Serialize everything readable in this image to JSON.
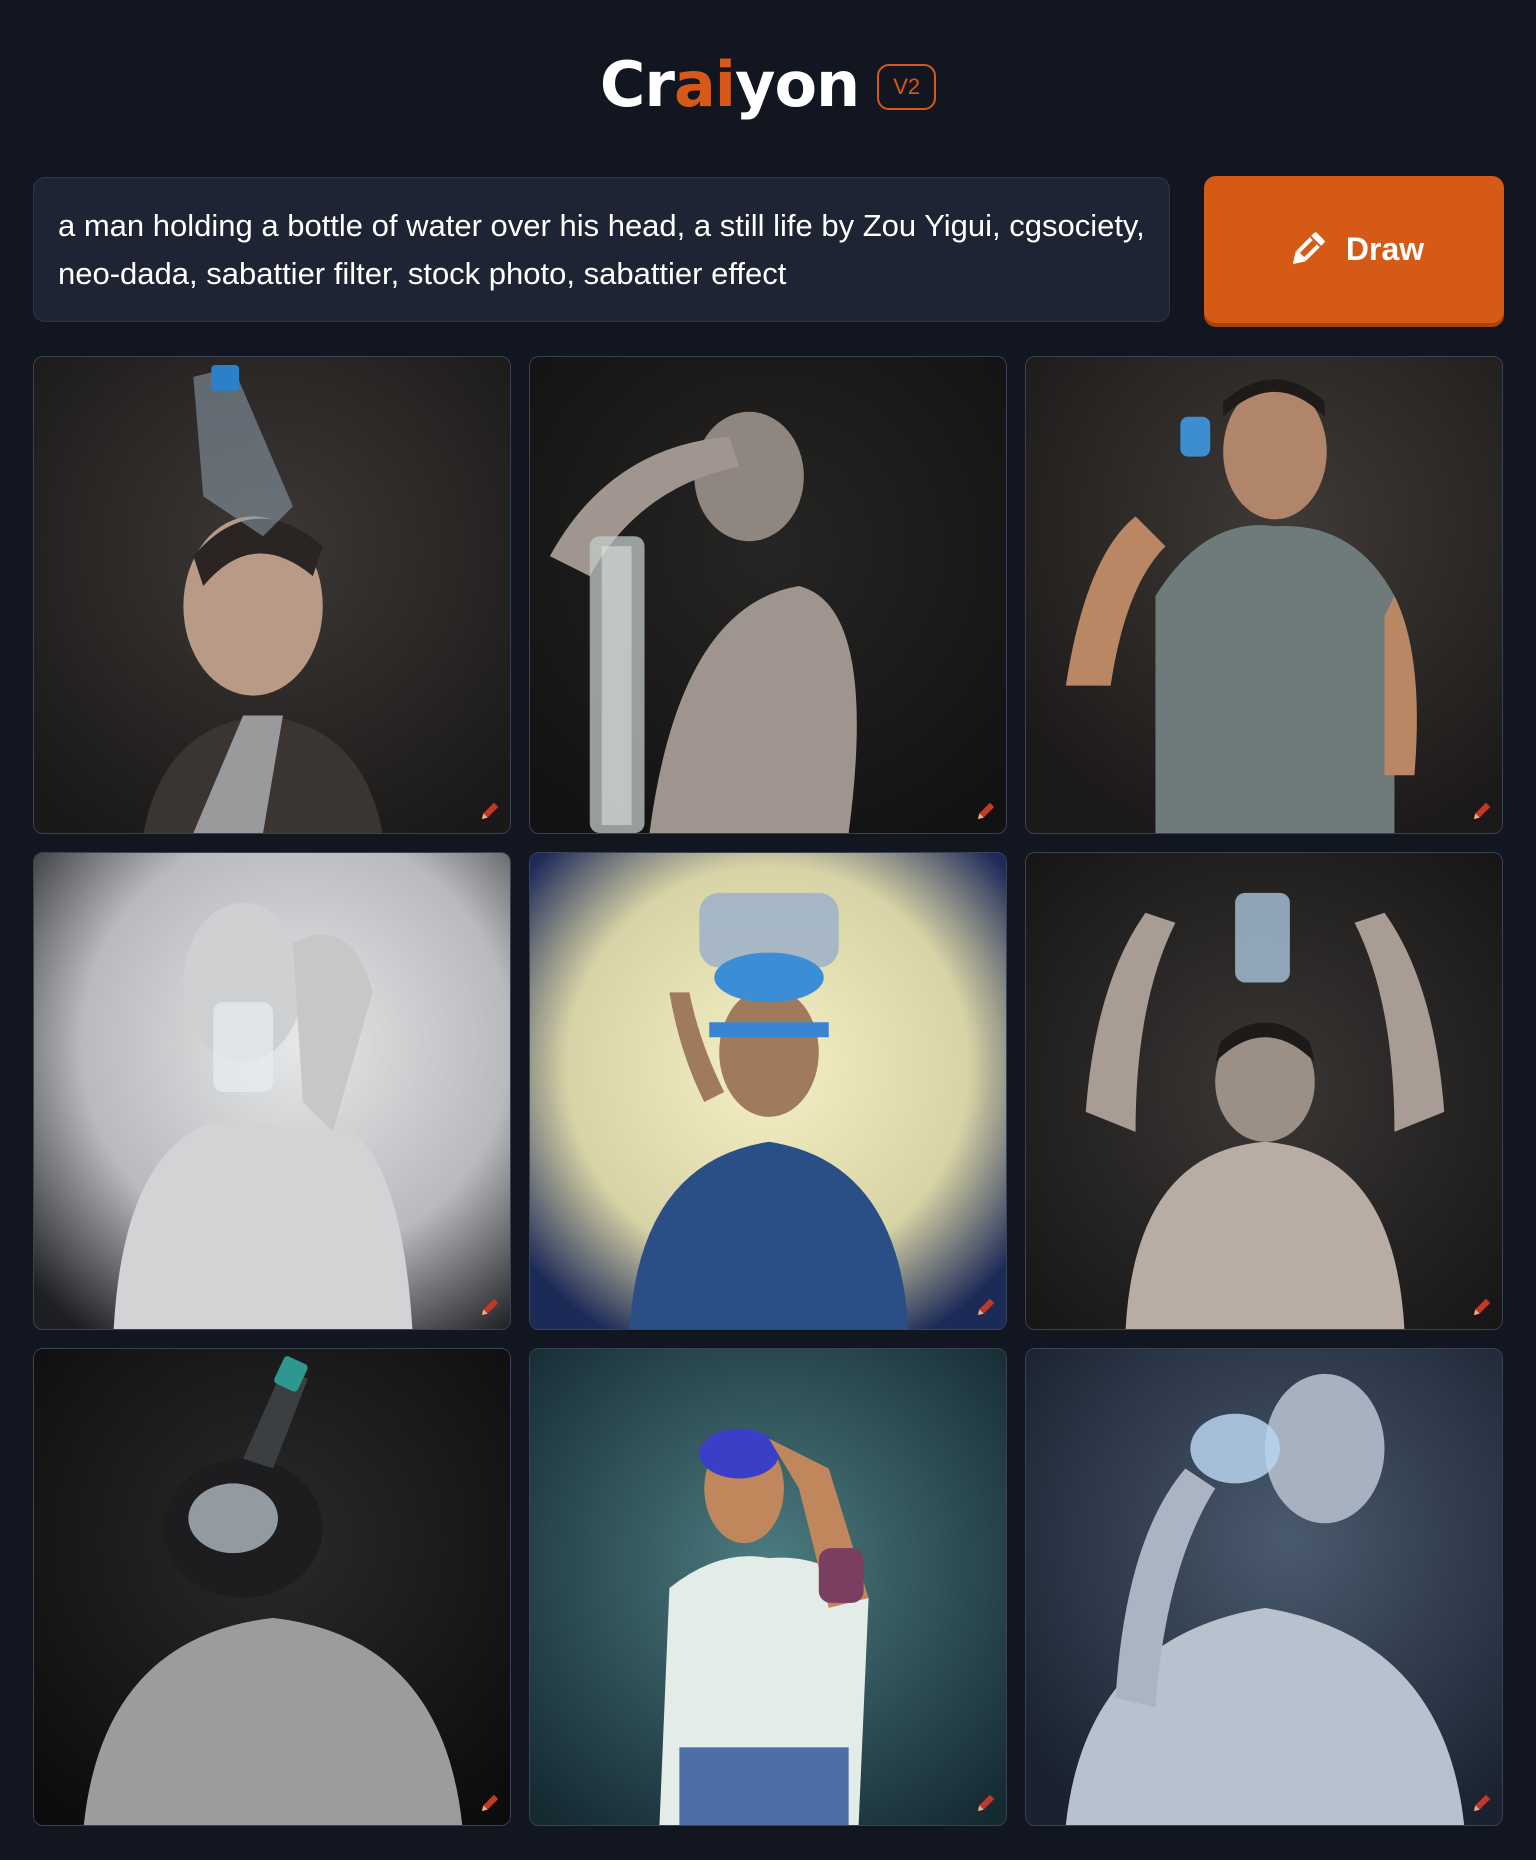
{
  "header": {
    "logo_part1": "Cr",
    "logo_part2": "ai",
    "logo_part3": "yon",
    "version_badge": "V2"
  },
  "prompt": {
    "text": "a man holding a bottle of water over his head, a still life by Zou Yigui, cgsociety, neo-dada, sabattier filter, stock photo, sabattier effect"
  },
  "draw_button": {
    "label": "Draw",
    "icon": "pencil-icon"
  },
  "colors": {
    "background": "#121621",
    "accent": "#d6591a",
    "prompt_bg": "#1e2433"
  },
  "results": [
    {
      "icon": "pencil-icon"
    },
    {
      "icon": "pencil-icon"
    },
    {
      "icon": "pencil-icon"
    },
    {
      "icon": "pencil-icon"
    },
    {
      "icon": "pencil-icon"
    },
    {
      "icon": "pencil-icon"
    },
    {
      "icon": "pencil-icon"
    },
    {
      "icon": "pencil-icon"
    },
    {
      "icon": "pencil-icon"
    }
  ]
}
